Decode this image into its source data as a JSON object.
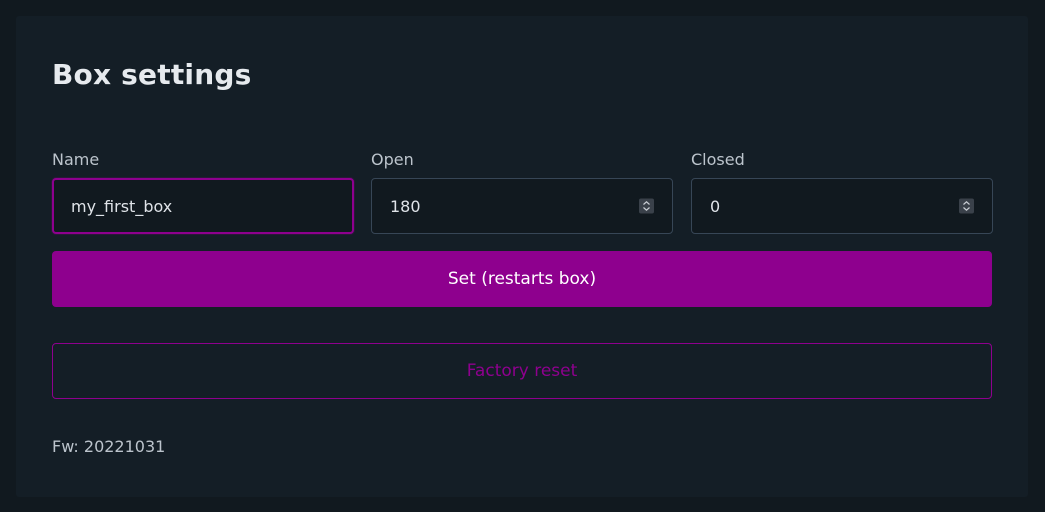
{
  "page": {
    "title": "Box settings"
  },
  "form": {
    "name": {
      "label": "Name",
      "value": "my_first_box"
    },
    "open": {
      "label": "Open",
      "value": "180"
    },
    "closed": {
      "label": "Closed",
      "value": "0"
    }
  },
  "actions": {
    "set_label": "Set (restarts box)",
    "reset_label": "Factory reset"
  },
  "footer": {
    "firmware": "Fw: 20221031"
  },
  "colors": {
    "accent": "#8e008e",
    "background": "#11191f",
    "card": "#141e26"
  },
  "icons": {
    "spinner": "spinner-arrows-icon"
  }
}
